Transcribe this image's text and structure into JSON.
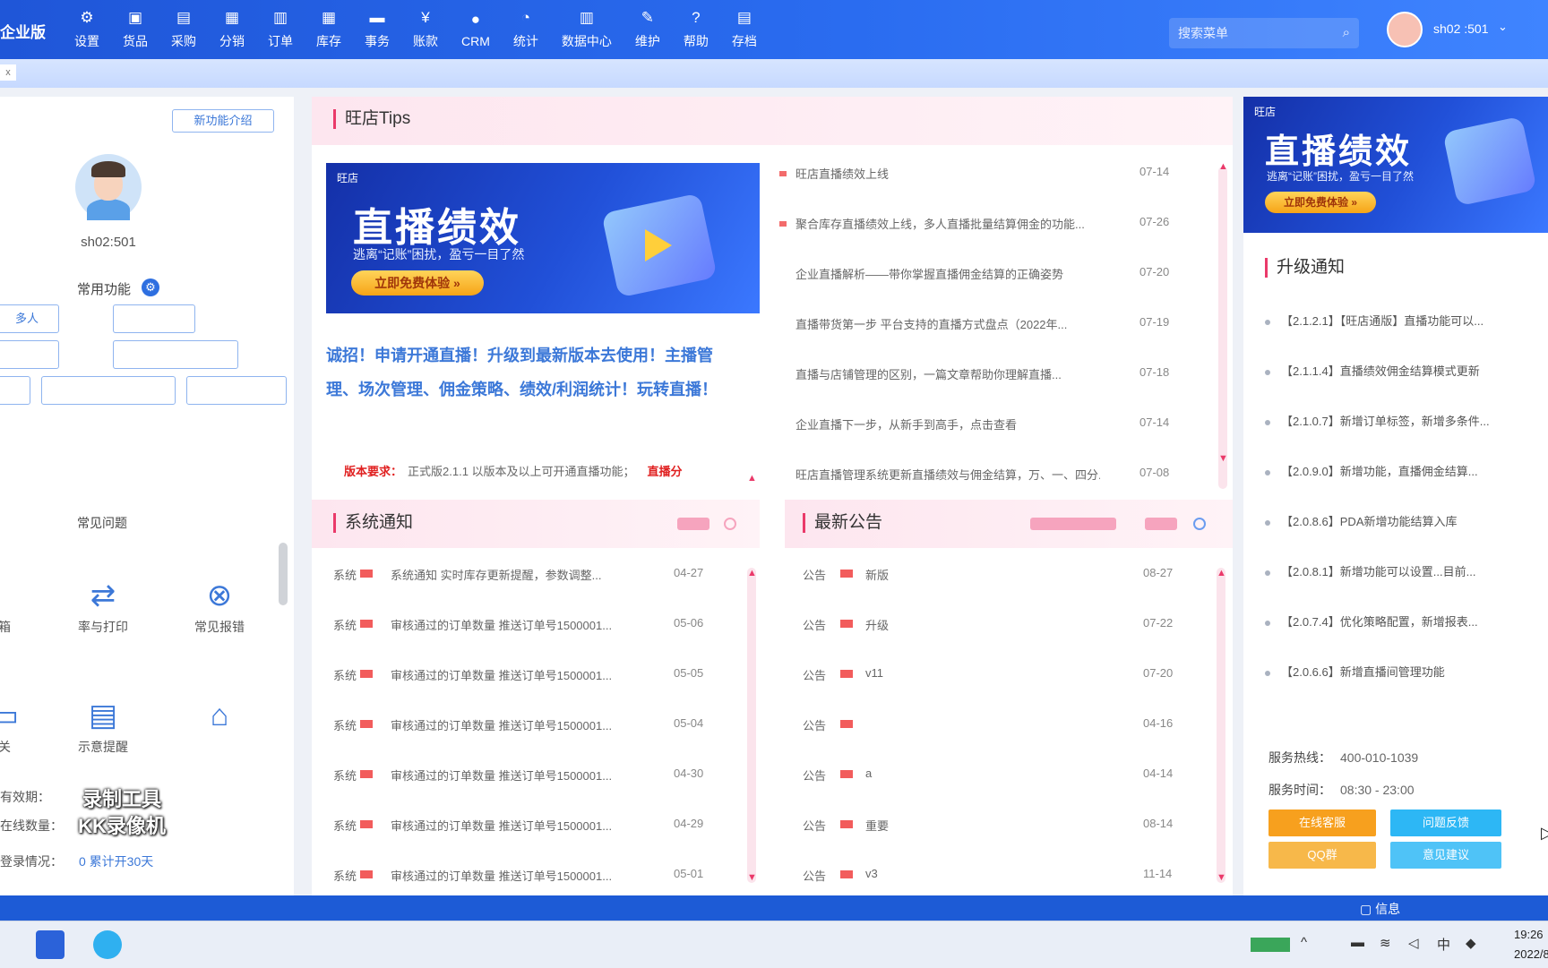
{
  "topbar": {
    "brand": "企业版",
    "nav": [
      {
        "label": "设置",
        "icon": "gear-icon",
        "glyph": "⚙"
      },
      {
        "label": "货品",
        "icon": "cube-icon",
        "glyph": "▣"
      },
      {
        "label": "采购",
        "icon": "cart-icon",
        "glyph": "▤"
      },
      {
        "label": "分销",
        "icon": "network-icon",
        "glyph": "▦"
      },
      {
        "label": "订单",
        "icon": "document-icon",
        "glyph": "▥"
      },
      {
        "label": "库存",
        "icon": "grid-icon",
        "glyph": "▦"
      },
      {
        "label": "事务",
        "icon": "chat-icon",
        "glyph": "▬"
      },
      {
        "label": "账款",
        "icon": "yen-icon",
        "glyph": "¥"
      },
      {
        "label": "CRM",
        "icon": "person-icon",
        "glyph": "●"
      },
      {
        "label": "统计",
        "icon": "pie-icon",
        "glyph": "◔"
      },
      {
        "label": "数据中心",
        "icon": "bar-chart-icon",
        "glyph": "▥"
      },
      {
        "label": "维护",
        "icon": "wrench-icon",
        "glyph": "✎"
      },
      {
        "label": "帮助",
        "icon": "help-icon",
        "glyph": "?"
      },
      {
        "label": "存档",
        "icon": "archive-icon",
        "glyph": "▤"
      }
    ],
    "search_placeholder": "搜索菜单",
    "username": "sh02 :501",
    "tab_close": "x"
  },
  "left": {
    "top_button": "新功能介绍",
    "username": "sh02:501",
    "common_functions": "常用功能",
    "quick_buttons": [
      "多人",
      "",
      "",
      "",
      "",
      "",
      ""
    ],
    "faq_title": "常见问题",
    "tools": [
      {
        "label": "率与打印",
        "icon": "swap-icon",
        "glyph": "⇄"
      },
      {
        "label": "常见报错",
        "icon": "close-circle-icon",
        "glyph": "⊗"
      },
      {
        "label": "关",
        "icon": "list-icon",
        "glyph": "▭"
      },
      {
        "label": "示意提醒",
        "icon": "form-icon",
        "glyph": "▤"
      },
      {
        "label": "",
        "icon": "store-icon",
        "glyph": "⌂"
      }
    ],
    "info_rows": [
      {
        "label": "有效期：",
        "value": ""
      },
      {
        "label": "在线数量：",
        "value": ""
      },
      {
        "label": "登录情况：",
        "value": "0 累计开30天"
      }
    ],
    "watermark_line1": "录制工具",
    "watermark_line2": "KK录像机"
  },
  "tips": {
    "title": "旺店Tips",
    "banner": {
      "logo": "旺店",
      "title": "直播绩效",
      "subtitle": "逃离“记账”困扰，盈亏一目了然",
      "button": "立即免费体验 »"
    },
    "promo": "诚招！申请开通直播！升级到最新版本去使用！主播管理、场次管理、佣金策略、绩效/利润统计！玩转直播！",
    "note_label": "版本要求：",
    "note_text": "正式版2.1.1 以版本及以上可开通直播功能；",
    "note_right": "直播分",
    "items": [
      {
        "text": "旺店直播绩效上线",
        "date": "07-14"
      },
      {
        "text": "聚合库存直播绩效上线，多人直播批量结算佣金的功能...",
        "date": "07-26"
      },
      {
        "text": "企业直播解析——带你掌握直播佣金结算的正确姿势",
        "date": "07-20"
      },
      {
        "text": "直播带货第一步 平台支持的直播方式盘点（2022年...",
        "date": "07-19"
      },
      {
        "text": "直播与店铺管理的区别，一篇文章帮助你理解直播...",
        "date": "07-18"
      },
      {
        "text": "企业直播下一步，从新手到高手，点击查看",
        "date": "07-14"
      },
      {
        "text": "旺店直播管理系统更新直播绩效与佣金结算，万、一、四分...",
        "date": "07-08"
      }
    ]
  },
  "system_notice": {
    "title": "系统通知",
    "items": [
      {
        "tag": "系统",
        "text": "系统通知 实时库存更新提醒，参数调整...",
        "date": "04-27"
      },
      {
        "tag": "系统",
        "text": "审核通过的订单数量 推送订单号1500001...",
        "date": "05-06"
      },
      {
        "tag": "系统",
        "text": "审核通过的订单数量 推送订单号1500001...",
        "date": "05-05"
      },
      {
        "tag": "系统",
        "text": "审核通过的订单数量 推送订单号1500001...",
        "date": "05-04"
      },
      {
        "tag": "系统",
        "text": "审核通过的订单数量 推送订单号1500001...",
        "date": "04-30"
      },
      {
        "tag": "系统",
        "text": "审核通过的订单数量 推送订单号1500001...",
        "date": "04-29"
      },
      {
        "tag": "系统",
        "text": "审核通过的订单数量 推送订单号1500001...",
        "date": "05-01"
      }
    ]
  },
  "announcements": {
    "title": "最新公告",
    "items": [
      {
        "tag": "公告",
        "text": "新版",
        "date": "08-27"
      },
      {
        "tag": "公告",
        "text": "升级",
        "date": "07-22"
      },
      {
        "tag": "公告",
        "text": "v11",
        "date": "07-20"
      },
      {
        "tag": "公告",
        "text": "",
        "date": "04-16"
      },
      {
        "tag": "公告",
        "text": "a",
        "date": "04-14"
      },
      {
        "tag": "公告",
        "text": "重要",
        "date": "08-14"
      },
      {
        "tag": "公告",
        "text": "v3",
        "date": "11-14"
      }
    ]
  },
  "right": {
    "banner": {
      "logo": "旺店",
      "title": "直播绩效",
      "subtitle": "逃离“记账”困扰，盈亏一目了然",
      "button": "立即免费体验 »"
    },
    "upgrade_title": "升级通知",
    "upgrades": [
      "【2.1.2.1】【旺店通版】直播功能可以...",
      "【2.1.1.4】直播绩效佣金结算模式更新",
      "【2.1.0.7】新增订单标签，新增多条件...",
      "【2.0.9.0】新增功能，直播佣金结算...",
      "【2.0.8.6】PDA新增功能结算入库",
      "【2.0.8.1】新增功能可以设置...目前...",
      "【2.0.7.4】优化策略配置，新增报表...",
      "【2.0.6.6】新增直播间管理功能"
    ],
    "hotline_label": "服务热线：",
    "hotline_value": "400-010-1039",
    "hours_label": "服务时间：",
    "hours_value": "08:30 - 23:00",
    "buttons": [
      "在线客服",
      "问题反馈",
      "QQ群",
      "意见建议"
    ]
  },
  "statusbar": {
    "info": "信息"
  },
  "taskbar": {
    "time": "19:26",
    "date": "2022/8"
  },
  "colors": {
    "primary": "#2a6cf0",
    "accent_pink": "#ea3a6a",
    "orange": "#f7a01e",
    "cyan": "#2db7f5"
  }
}
